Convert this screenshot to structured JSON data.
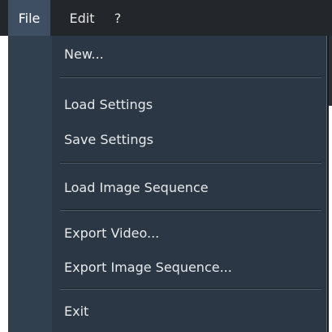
{
  "menubar": {
    "file": "File",
    "edit": "Edit",
    "help": "?"
  },
  "file_menu": {
    "new": "New...",
    "load_settings": "Load Settings",
    "save_settings": "Save Settings",
    "load_image_sequence": "Load Image Sequence",
    "export_video": "Export Video...",
    "export_image_sequence": "Export Image Sequence...",
    "exit": "Exit"
  },
  "colors": {
    "menubar_bg": "#23262a",
    "active_menu_bg": "#3f4f63",
    "dropdown_bg": "#2b3744",
    "gutter_bg": "#30404f",
    "text": "#e7e9eb"
  }
}
